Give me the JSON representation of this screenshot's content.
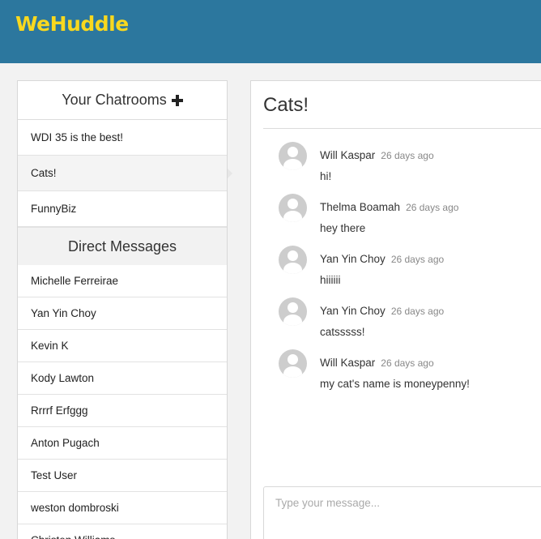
{
  "app": {
    "logo": "WeHuddle"
  },
  "sidebar": {
    "chatrooms_title": "Your Chatrooms",
    "chatrooms": [
      {
        "label": "WDI 35 is the best!"
      },
      {
        "label": "Cats!"
      },
      {
        "label": "FunnyBiz"
      }
    ],
    "active_chatroom": "Cats!",
    "dm_title": "Direct Messages",
    "direct_messages": [
      {
        "label": "Michelle Ferreirae"
      },
      {
        "label": "Yan Yin Choy"
      },
      {
        "label": "Kevin K"
      },
      {
        "label": "Kody Lawton"
      },
      {
        "label": "Rrrrf Erfggg"
      },
      {
        "label": "Anton Pugach"
      },
      {
        "label": "Test User"
      },
      {
        "label": "weston dombroski"
      },
      {
        "label": "Christen Williams"
      }
    ]
  },
  "room": {
    "title": "Cats!",
    "messages": [
      {
        "author": "Will Kaspar",
        "time": "26 days ago",
        "text": "hi!"
      },
      {
        "author": "Thelma Boamah",
        "time": "26 days ago",
        "text": "hey there"
      },
      {
        "author": "Yan Yin Choy",
        "time": "26 days ago",
        "text": "hiiiiii"
      },
      {
        "author": "Yan Yin Choy",
        "time": "26 days ago",
        "text": "catsssss!"
      },
      {
        "author": "Will Kaspar",
        "time": "26 days ago",
        "text": "my cat's name is moneypenny!"
      }
    ],
    "composer_placeholder": "Type your message..."
  },
  "colors": {
    "topbar": "#2c779e",
    "logo": "#f8d81f"
  }
}
